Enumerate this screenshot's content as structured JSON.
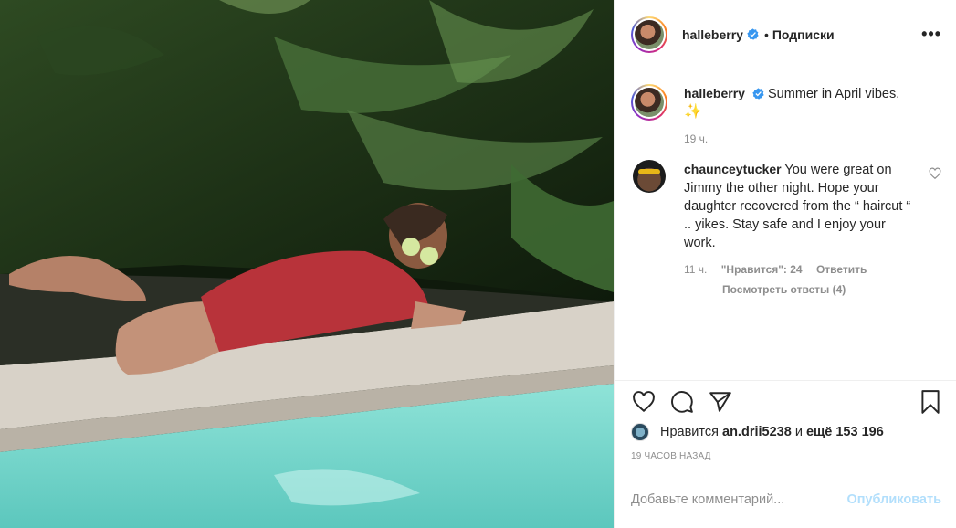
{
  "header": {
    "username": "halleberry",
    "separator": "•",
    "follow_label": "Подписки",
    "more_icon": "more-dots-icon"
  },
  "caption": {
    "username": "halleberry",
    "text": "Summer in April vibes.",
    "emoji": "✨",
    "time": "19 ч."
  },
  "comments": [
    {
      "username": "chaunceytucker",
      "text": "You were great on Jimmy the other night. Hope your daughter recovered from the “ haircut “ .. yikes. Stay safe and I enjoy your work.",
      "time": "11 ч.",
      "likes": "\"Нравится\": 24",
      "reply": "Ответить",
      "view_replies": "Посмотреть ответы (4)"
    }
  ],
  "actions": {
    "like_icon": "heart-icon",
    "comment_icon": "comment-icon",
    "share_icon": "share-icon",
    "save_icon": "bookmark-icon"
  },
  "likes": {
    "prefix": "Нравится",
    "user": "an.drii5238",
    "conj": "и",
    "others": "ещё 153 196"
  },
  "posted_ago": "19 часов назад",
  "add_comment": {
    "placeholder": "Добавьте комментарий...",
    "publish": "Опубликовать"
  },
  "colors": {
    "verified": "#3897f0",
    "publish_disabled": "#b2dffc",
    "text": "#262626",
    "muted": "#8e8e8e",
    "pool": "#7fd9d0"
  }
}
